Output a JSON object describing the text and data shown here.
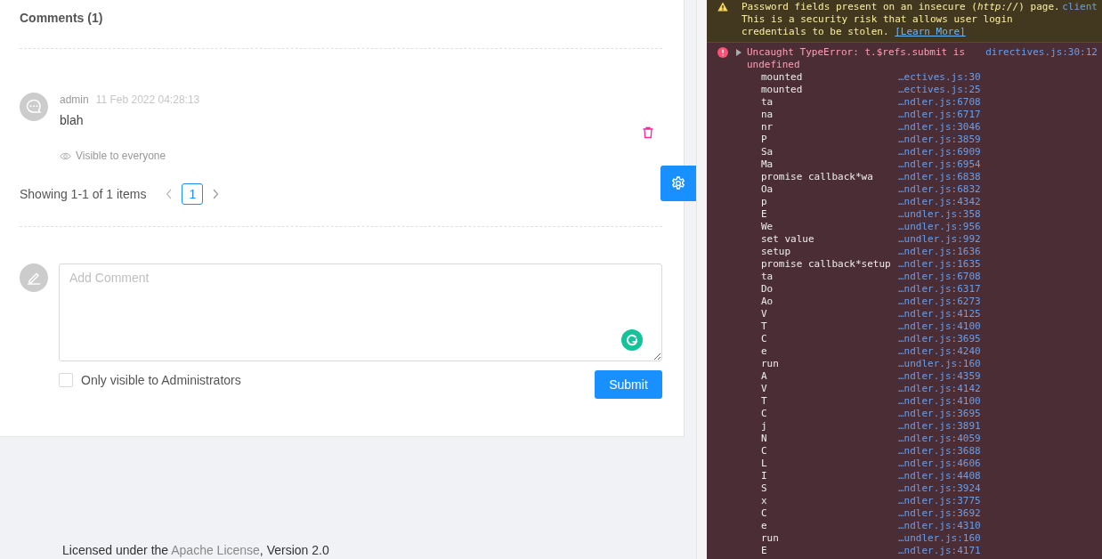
{
  "page": {
    "comments_title": "Comments (1)",
    "comments": [
      {
        "author": "admin",
        "time": "11 Feb 2022 04:28:13",
        "text": "blah",
        "visibility": "Visible to everyone"
      }
    ],
    "pagination": {
      "summary": "Showing 1-1 of 1 items",
      "pages": [
        {
          "label": "1",
          "selected": true
        }
      ]
    },
    "editor": {
      "placeholder": "Add Comment",
      "admin_only": {
        "label": "Only visible to Administrators",
        "checked": false
      },
      "submit": "Submit"
    },
    "footer": {
      "prefix": "Licensed under the ",
      "link": "Apache License",
      "suffix": ", Version 2.0"
    }
  },
  "console": {
    "messages": [
      {
        "kind": "warning",
        "text": "Password fields present on an insecure (*http://*) page. This is a security risk that allows user login credentials to be stolen.",
        "link": "[Learn More]",
        "source": "client"
      },
      {
        "kind": "error",
        "expanded": false,
        "text": "Uncaught TypeError: t.$refs.submit is undefined",
        "source": "directives.js:30:12",
        "stack": [
          {
            "fn": "mounted",
            "loc": "…ectives.js:30"
          },
          {
            "fn": "mounted",
            "loc": "…ectives.js:25"
          },
          {
            "fn": "ta",
            "loc": "…ndler.js:6708"
          },
          {
            "fn": "na",
            "loc": "…ndler.js:6717"
          },
          {
            "fn": "nr",
            "loc": "…ndler.js:3046"
          },
          {
            "fn": "P",
            "loc": "…ndler.js:3859"
          },
          {
            "fn": "Sa",
            "loc": "…ndler.js:6909"
          },
          {
            "fn": "Ma",
            "loc": "…ndler.js:6954"
          },
          {
            "fn": "promise callback*wa",
            "loc": "…ndler.js:6838"
          },
          {
            "fn": "Oa",
            "loc": "…ndler.js:6832"
          },
          {
            "fn": "p",
            "loc": "…ndler.js:4342"
          },
          {
            "fn": "E",
            "loc": "…undler.js:358"
          },
          {
            "fn": "We",
            "loc": "…undler.js:956"
          },
          {
            "fn": "set value",
            "loc": "…undler.js:992"
          },
          {
            "fn": "setup",
            "loc": "…ndler.js:1636"
          },
          {
            "fn": "promise callback*setup",
            "loc": "…ndler.js:1635"
          },
          {
            "fn": "ta",
            "loc": "…ndler.js:6708"
          },
          {
            "fn": "Do",
            "loc": "…ndler.js:6317"
          },
          {
            "fn": "Ao",
            "loc": "…ndler.js:6273"
          },
          {
            "fn": "V",
            "loc": "…ndler.js:4125"
          },
          {
            "fn": "T",
            "loc": "…ndler.js:4100"
          },
          {
            "fn": "C",
            "loc": "…ndler.js:3695"
          },
          {
            "fn": "e",
            "loc": "…ndler.js:4240"
          },
          {
            "fn": "run",
            "loc": "…undler.js:160"
          },
          {
            "fn": "A",
            "loc": "…ndler.js:4359"
          },
          {
            "fn": "V",
            "loc": "…ndler.js:4142"
          },
          {
            "fn": "T",
            "loc": "…ndler.js:4100"
          },
          {
            "fn": "C",
            "loc": "…ndler.js:3695"
          },
          {
            "fn": "j",
            "loc": "…ndler.js:3891"
          },
          {
            "fn": "N",
            "loc": "…ndler.js:4059"
          },
          {
            "fn": "C",
            "loc": "…ndler.js:3688"
          },
          {
            "fn": "L",
            "loc": "…ndler.js:4606"
          },
          {
            "fn": "I",
            "loc": "…ndler.js:4408"
          },
          {
            "fn": "S",
            "loc": "…ndler.js:3924"
          },
          {
            "fn": "x",
            "loc": "…ndler.js:3775"
          },
          {
            "fn": "C",
            "loc": "…ndler.js:3692"
          },
          {
            "fn": "e",
            "loc": "…ndler.js:4310"
          },
          {
            "fn": "run",
            "loc": "…undler.js:160"
          },
          {
            "fn": "E",
            "loc": "…ndler.js:4171"
          }
        ]
      }
    ]
  }
}
